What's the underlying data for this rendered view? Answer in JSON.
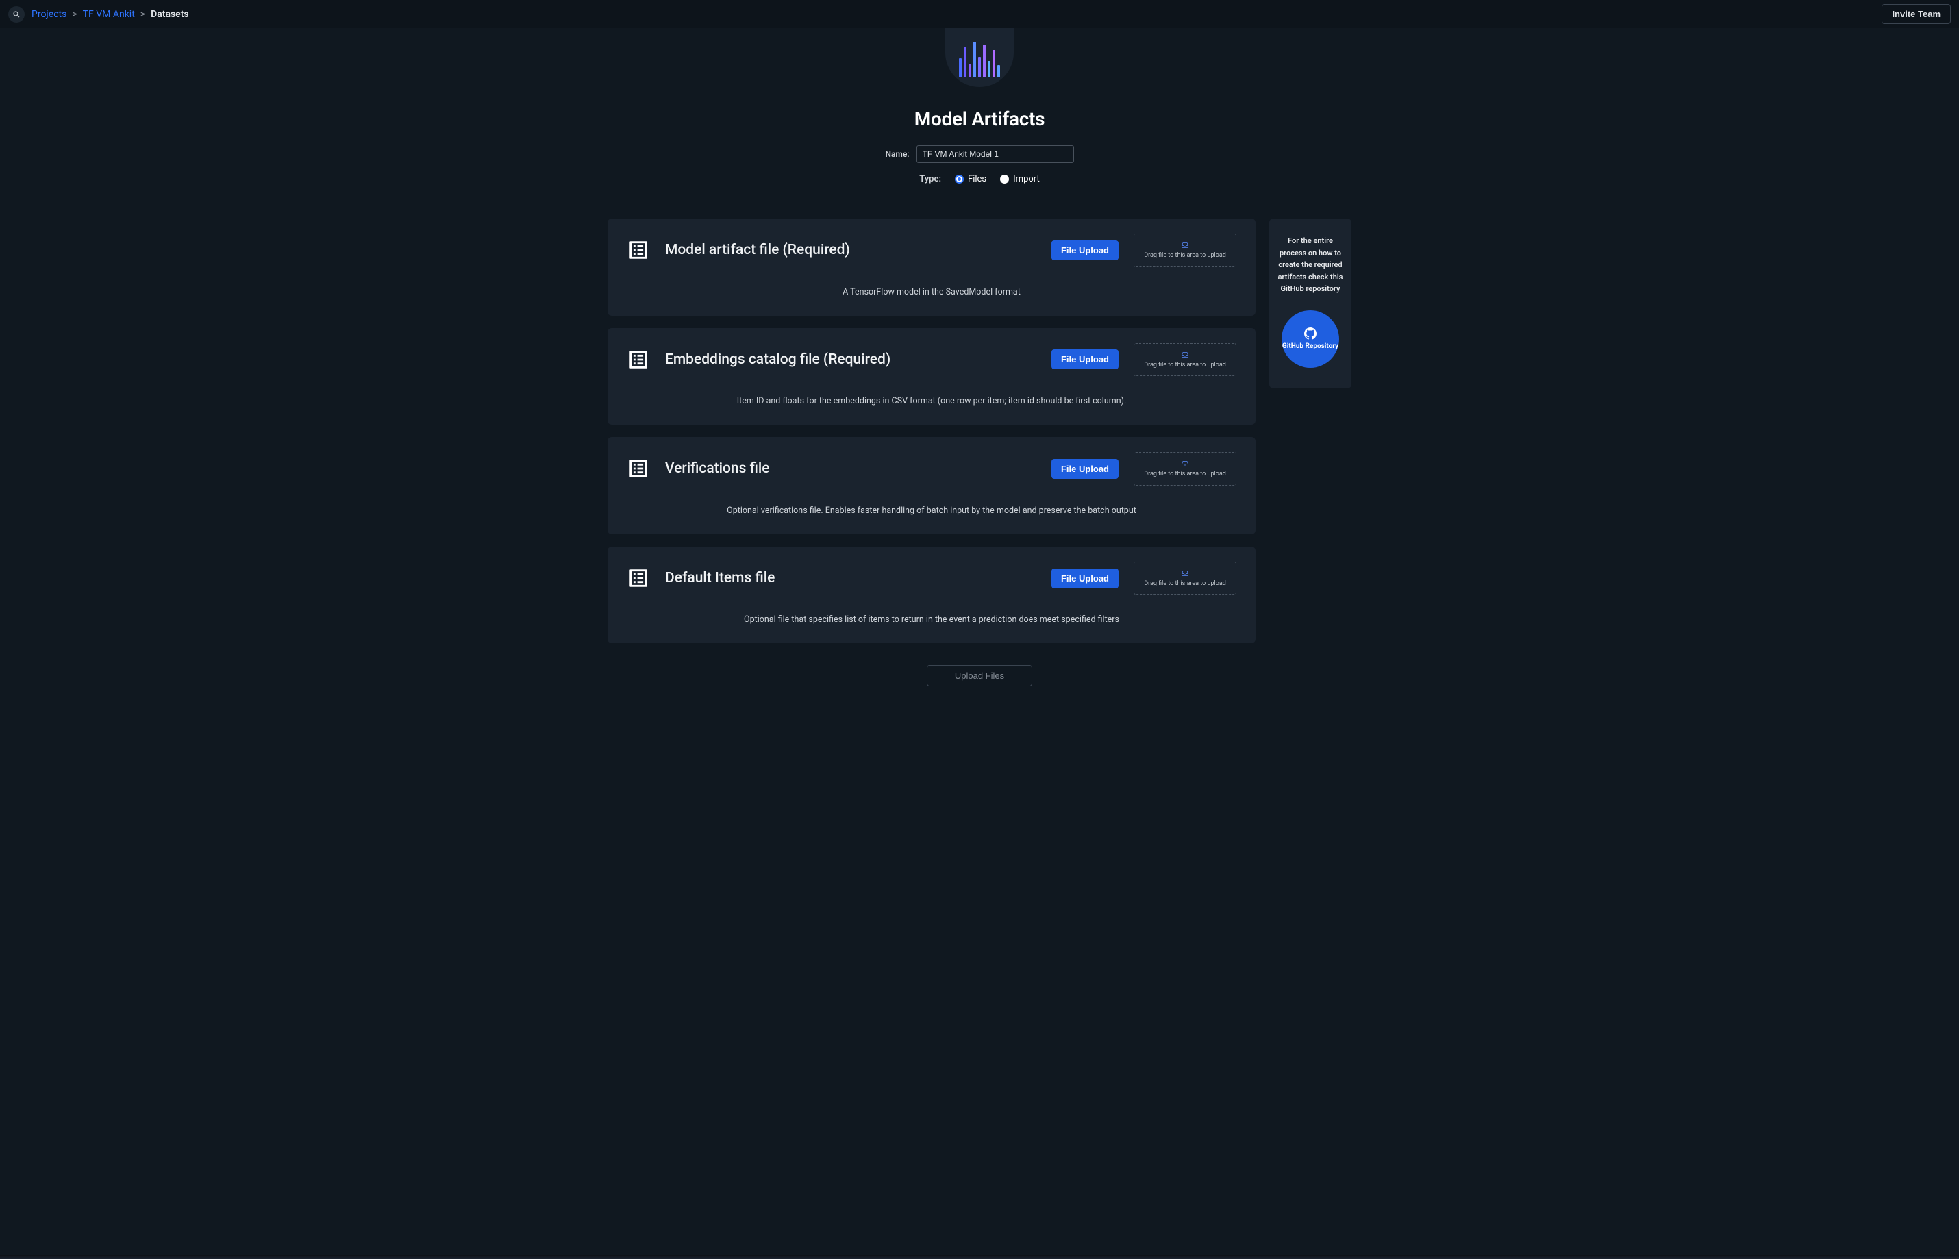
{
  "topbar": {
    "breadcrumbs": {
      "projects": "Projects",
      "project_name": "TF VM Ankit",
      "current": "Datasets"
    },
    "invite_label": "Invite Team"
  },
  "hero": {
    "title": "Model Artifacts",
    "name_label": "Name:",
    "name_value": "TF VM Ankit Model 1",
    "type_label": "Type:",
    "type_files": "Files",
    "type_import": "Import"
  },
  "common": {
    "upload_btn": "File Upload",
    "drag_text": "Drag file to this area to upload"
  },
  "cards": [
    {
      "title": "Model artifact file (Required)",
      "desc": "A TensorFlow model in the SavedModel format"
    },
    {
      "title": "Embeddings catalog file (Required)",
      "desc": "Item ID and floats for the embeddings in CSV format (one row per item; item id should be first column)."
    },
    {
      "title": "Verifications file",
      "desc": "Optional verifications file. Enables faster handling of batch input by the model and preserve the batch output"
    },
    {
      "title": "Default Items file",
      "desc": "Optional file that specifies list of items to return in the event a prediction does meet specified filters"
    }
  ],
  "side": {
    "text": "For the entire process on how to create the required artifacts check this GitHub repository",
    "link_label": "GitHub Repository"
  },
  "footer": {
    "upload_files": "Upload Files"
  }
}
